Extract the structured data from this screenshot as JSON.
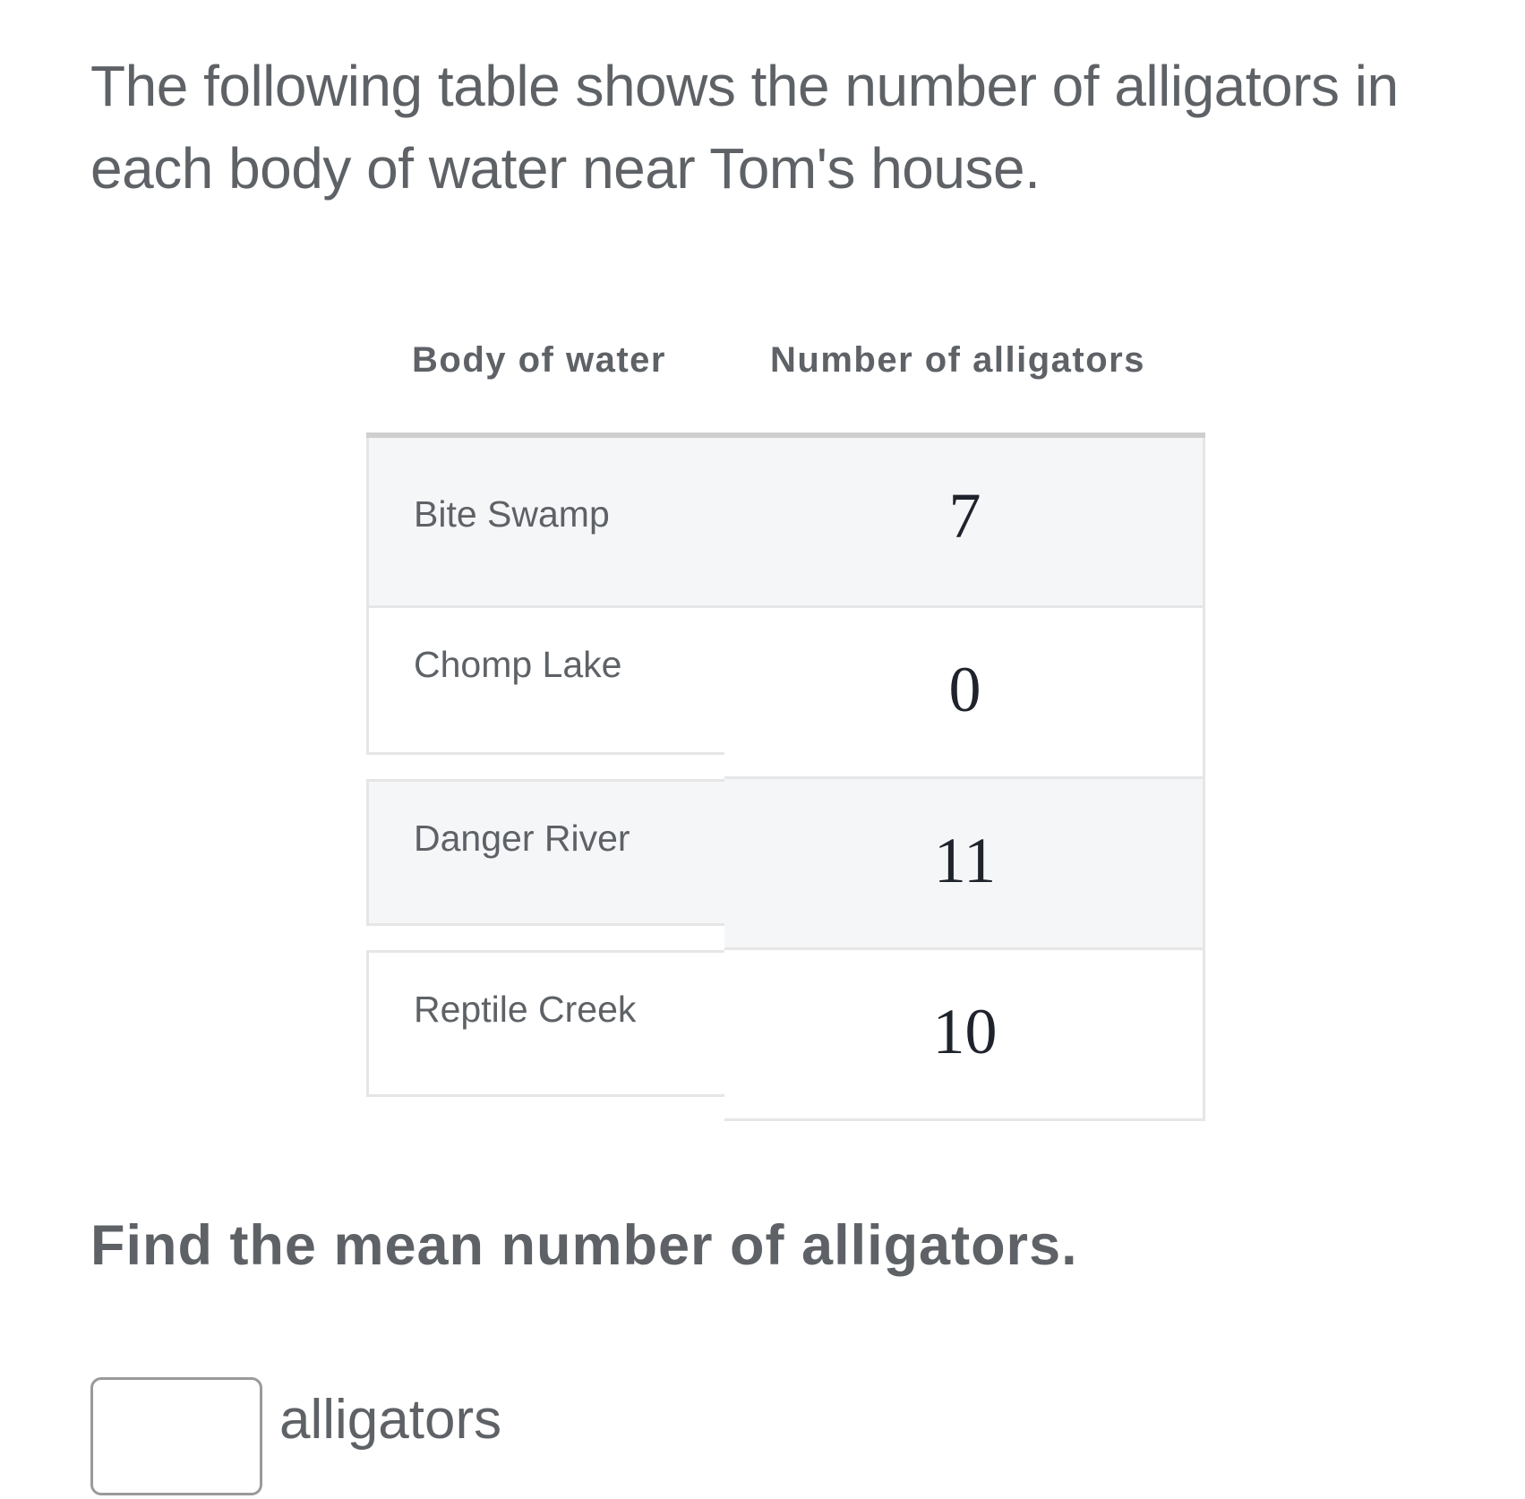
{
  "question": {
    "intro_line1": "The following table shows the number of alligators in",
    "intro_line2": "each body of water near Tom's house.",
    "prompt": "Find the mean number of alligators."
  },
  "table": {
    "headers": [
      "Body of water",
      "Number of alligators"
    ],
    "rows": [
      {
        "name": "Bite Swamp",
        "value": "7"
      },
      {
        "name": "Chomp Lake",
        "value": "0"
      },
      {
        "name": "Danger River",
        "value": "11"
      },
      {
        "name": "Reptile Creek",
        "value": "10"
      }
    ]
  },
  "answer": {
    "value": "",
    "placeholder": "",
    "unit_label": "alligators"
  },
  "colors": {
    "text": "#5e6266",
    "number_text": "#1f232b",
    "shaded_row": "#f5f6f8",
    "border": "#e6e6e6",
    "header_rule": "#cfcfcf"
  }
}
